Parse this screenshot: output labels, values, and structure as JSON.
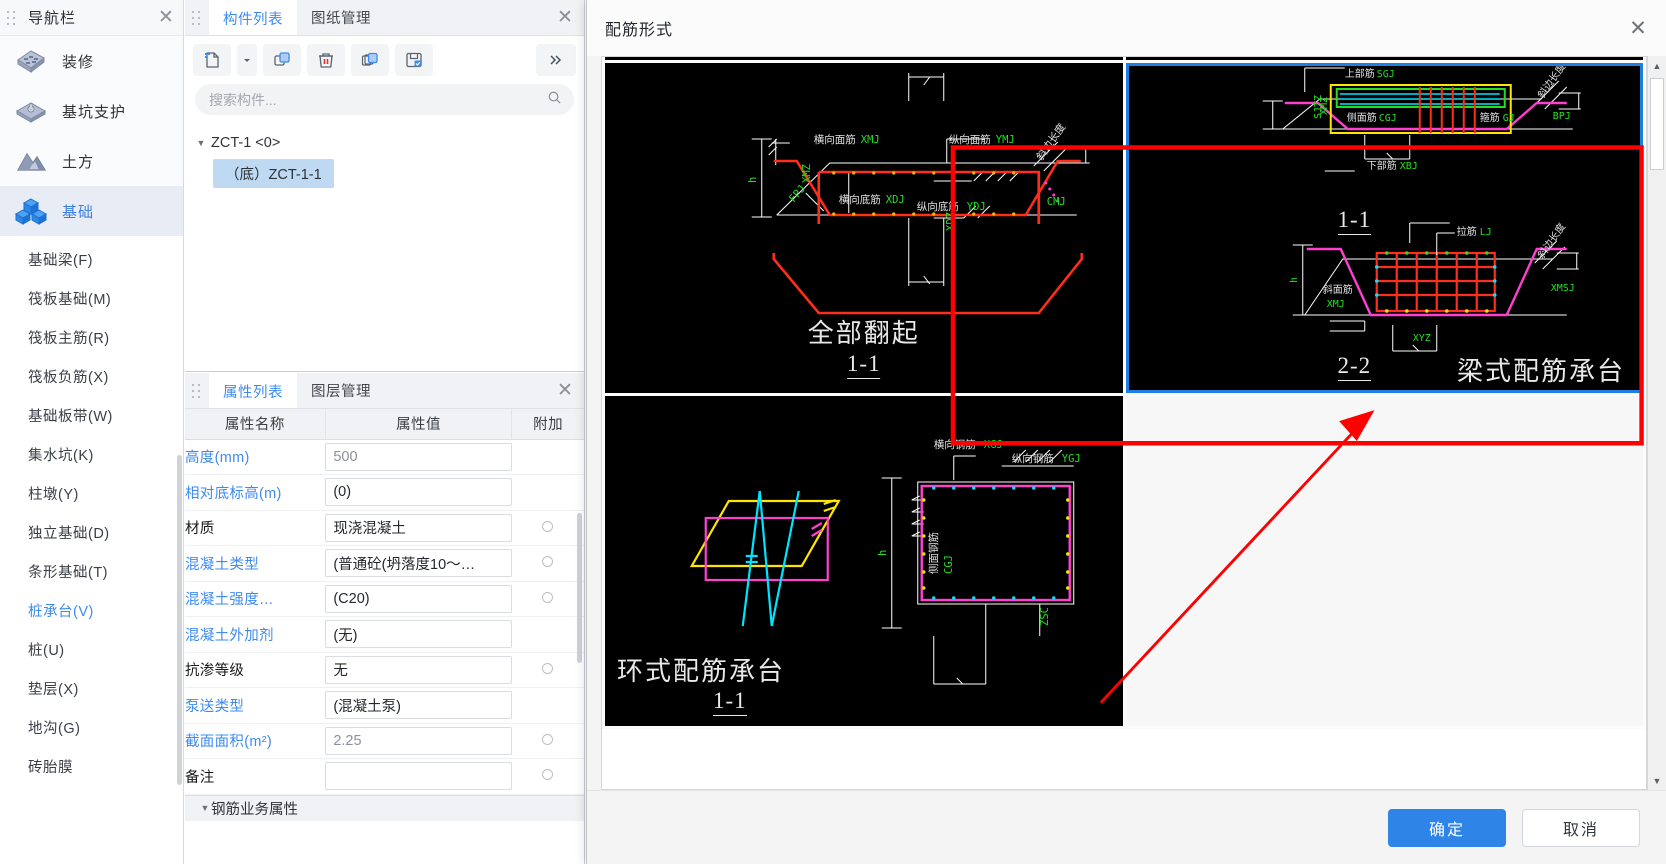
{
  "nav": {
    "title": "导航栏",
    "close_icon": "close-icon",
    "modules": [
      {
        "label": "装修",
        "icon": "decoration-icon",
        "active": false
      },
      {
        "label": "基坑支护",
        "icon": "foundation-pit-support-icon",
        "active": false
      },
      {
        "label": "土方",
        "icon": "earthwork-icon",
        "active": false
      },
      {
        "label": "基础",
        "icon": "foundation-icon",
        "active": true
      }
    ],
    "sub_items": [
      {
        "label": "基础梁(F)",
        "selected": false
      },
      {
        "label": "筏板基础(M)",
        "selected": false
      },
      {
        "label": "筏板主筋(R)",
        "selected": false
      },
      {
        "label": "筏板负筋(X)",
        "selected": false
      },
      {
        "label": "基础板带(W)",
        "selected": false
      },
      {
        "label": "集水坑(K)",
        "selected": false
      },
      {
        "label": "柱墩(Y)",
        "selected": false
      },
      {
        "label": "独立基础(D)",
        "selected": false
      },
      {
        "label": "条形基础(T)",
        "selected": false
      },
      {
        "label": "桩承台(V)",
        "selected": true
      },
      {
        "label": "桩(U)",
        "selected": false
      },
      {
        "label": "垫层(X)",
        "selected": false
      },
      {
        "label": "地沟(G)",
        "selected": false
      },
      {
        "label": "砖胎膜",
        "selected": false
      }
    ]
  },
  "component_panel": {
    "tabs": [
      {
        "label": "构件列表",
        "active": true
      },
      {
        "label": "图纸管理",
        "active": false
      }
    ],
    "close_icon": "close-icon",
    "toolbar": [
      {
        "name": "new-component-button",
        "icon": "new-file-icon"
      },
      {
        "name": "new-component-dropdown",
        "icon": "chevron-down-icon"
      },
      {
        "name": "copy-component-button",
        "icon": "copy-icon"
      },
      {
        "name": "delete-component-button",
        "icon": "trash-icon"
      },
      {
        "name": "duplicate-component-button",
        "icon": "layers-copy-icon"
      },
      {
        "name": "save-component-button",
        "icon": "save-image-icon"
      },
      {
        "name": "expand-toolbar-button",
        "icon": "double-chevron-right-icon"
      }
    ],
    "search": {
      "placeholder": "搜索构件...",
      "value": "",
      "icon": "search-icon"
    },
    "tree": {
      "root": {
        "label": "ZCT-1 <0>",
        "expanded": true,
        "caret": "caret-down-icon"
      },
      "children": [
        {
          "label": "（底）ZCT-1-1",
          "selected": true
        }
      ]
    }
  },
  "property_panel": {
    "tabs": [
      {
        "label": "属性列表",
        "active": true
      },
      {
        "label": "图层管理",
        "active": false
      }
    ],
    "close_icon": "close-icon",
    "columns": [
      "属性名称",
      "属性值",
      "附加"
    ],
    "rows": [
      {
        "name": "高度(mm)",
        "name_blue": true,
        "value": "500",
        "value_grey": true,
        "attach": false
      },
      {
        "name": "相对底标高(m)",
        "name_blue": true,
        "value": "(0)",
        "value_grey": false,
        "attach": false
      },
      {
        "name": "材质",
        "name_blue": false,
        "value": "现浇混凝土",
        "value_grey": false,
        "attach": true
      },
      {
        "name": "混凝土类型",
        "name_blue": true,
        "value": "(普通砼(坍落度10～…",
        "value_grey": false,
        "attach": true
      },
      {
        "name": "混凝土强度…",
        "name_blue": true,
        "value": "(C20)",
        "value_grey": false,
        "attach": true
      },
      {
        "name": "混凝土外加剂",
        "name_blue": true,
        "value": "(无)",
        "value_grey": false,
        "attach": false
      },
      {
        "name": "抗渗等级",
        "name_blue": false,
        "value": "无",
        "value_grey": false,
        "attach": true
      },
      {
        "name": "泵送类型",
        "name_blue": true,
        "value": "(混凝土泵)",
        "value_grey": false,
        "attach": false
      },
      {
        "name": "截面面积(m²)",
        "name_blue": true,
        "value": "2.25",
        "value_grey": true,
        "attach": true
      },
      {
        "name": "备注",
        "name_blue": false,
        "value": "",
        "value_grey": false,
        "attach": true
      }
    ],
    "footer_row": "钢筋业务属性"
  },
  "dialog": {
    "title": "配筋形式",
    "close_icon": "close-icon",
    "scrollbar": {
      "up_icon": "triangle-up-icon",
      "down_icon": "triangle-down-icon"
    },
    "buttons": {
      "confirm": "确定",
      "cancel": "取消"
    },
    "diagrams": [
      {
        "id": "cell-partial-left",
        "partial": true,
        "title": "",
        "section": ""
      },
      {
        "id": "cell-partial-right",
        "partial": true,
        "title": "",
        "section": ""
      },
      {
        "id": "all-turned-up",
        "title": "全部翻起",
        "section": "1-1",
        "selected": false,
        "labels": [
          "横向面筋XMJ",
          "纵向面筋YMJ",
          "横向底筋XDJ",
          "纵向底筋YDJ",
          "CMJ",
          "XMJ",
          "YDJ",
          "h"
        ]
      },
      {
        "id": "beam-reinforced-cap",
        "title": "梁式配筋承台",
        "sections": [
          "1-1",
          "2-2"
        ],
        "selected": true,
        "labels": [
          "上部筋SGJ",
          "下部筋XBJ",
          "侧面筋CGJ",
          "箍筋GJ",
          "拉筋LJ",
          "斜面筋XMJ",
          "XMSJ",
          "XYZ",
          "BPJ"
        ]
      },
      {
        "id": "ring-reinforced-cap",
        "title": "环式配筋承台",
        "section": "1-1",
        "selected": false,
        "labels": [
          "横向钢筋XGJ",
          "纵向钢筋YGJ",
          "侧面钢筋CGJ",
          "h",
          "ZSC"
        ]
      }
    ],
    "annotation": {
      "type": "red-callout",
      "color": "#ff0000",
      "description": "红色矩形框与箭头标注选中的梁式配筋承台图例"
    }
  },
  "colors": {
    "accent": "#3d8bf2",
    "primary_button": "#2f84e8",
    "selection_fill": "#bfd9f2",
    "selected_diagram_border": "#1f7fe0",
    "annotation_red": "#ff0000",
    "canvas_black": "#000000"
  }
}
